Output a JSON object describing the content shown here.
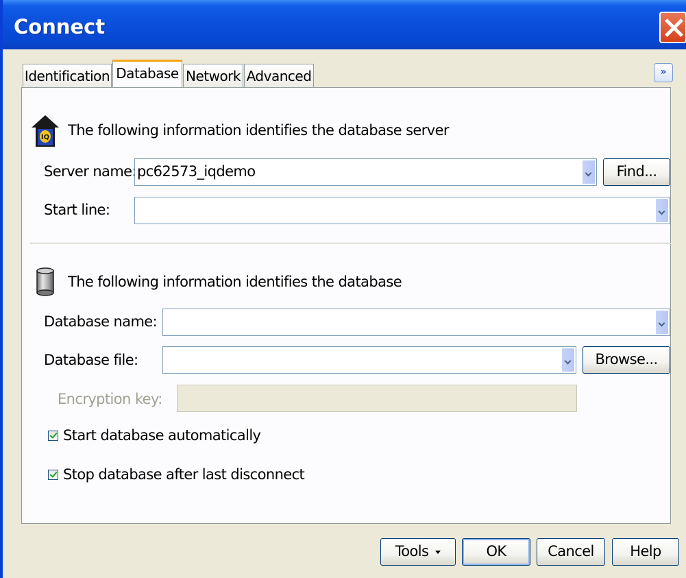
{
  "window": {
    "title": "Connect"
  },
  "tabs": [
    {
      "label": "Identification",
      "active": false
    },
    {
      "label": "Database",
      "active": true
    },
    {
      "label": "Network",
      "active": false
    },
    {
      "label": "Advanced",
      "active": false
    }
  ],
  "server_section": {
    "heading": "The following information identifies the database server",
    "icon": "iq-server-icon",
    "server_name_label": "Server name:",
    "server_name_value": "pc62573_iqdemo",
    "find_button": "Find...",
    "start_line_label": "Start line:",
    "start_line_value": ""
  },
  "database_section": {
    "heading": "The following information identifies the database",
    "icon": "database-cylinder-icon",
    "database_name_label": "Database name:",
    "database_name_value": "",
    "database_file_label": "Database file:",
    "database_file_value": "",
    "browse_button": "Browse...",
    "encryption_key_label": "Encryption key:",
    "encryption_key_value": ""
  },
  "options": [
    {
      "label": "Start database automatically",
      "checked": true
    },
    {
      "label": "Stop database after last disconnect",
      "checked": true
    }
  ],
  "footer": {
    "tools_button": "Tools",
    "ok_button": "OK",
    "cancel_button": "Cancel",
    "help_button": "Help"
  },
  "colors": {
    "title_bar": "#0a4fdb",
    "dialog_bg": "#ece9d8",
    "panel_bg": "#fcfcfe",
    "active_tab_accent": "#f7a518",
    "close_button": "#d4421c"
  }
}
